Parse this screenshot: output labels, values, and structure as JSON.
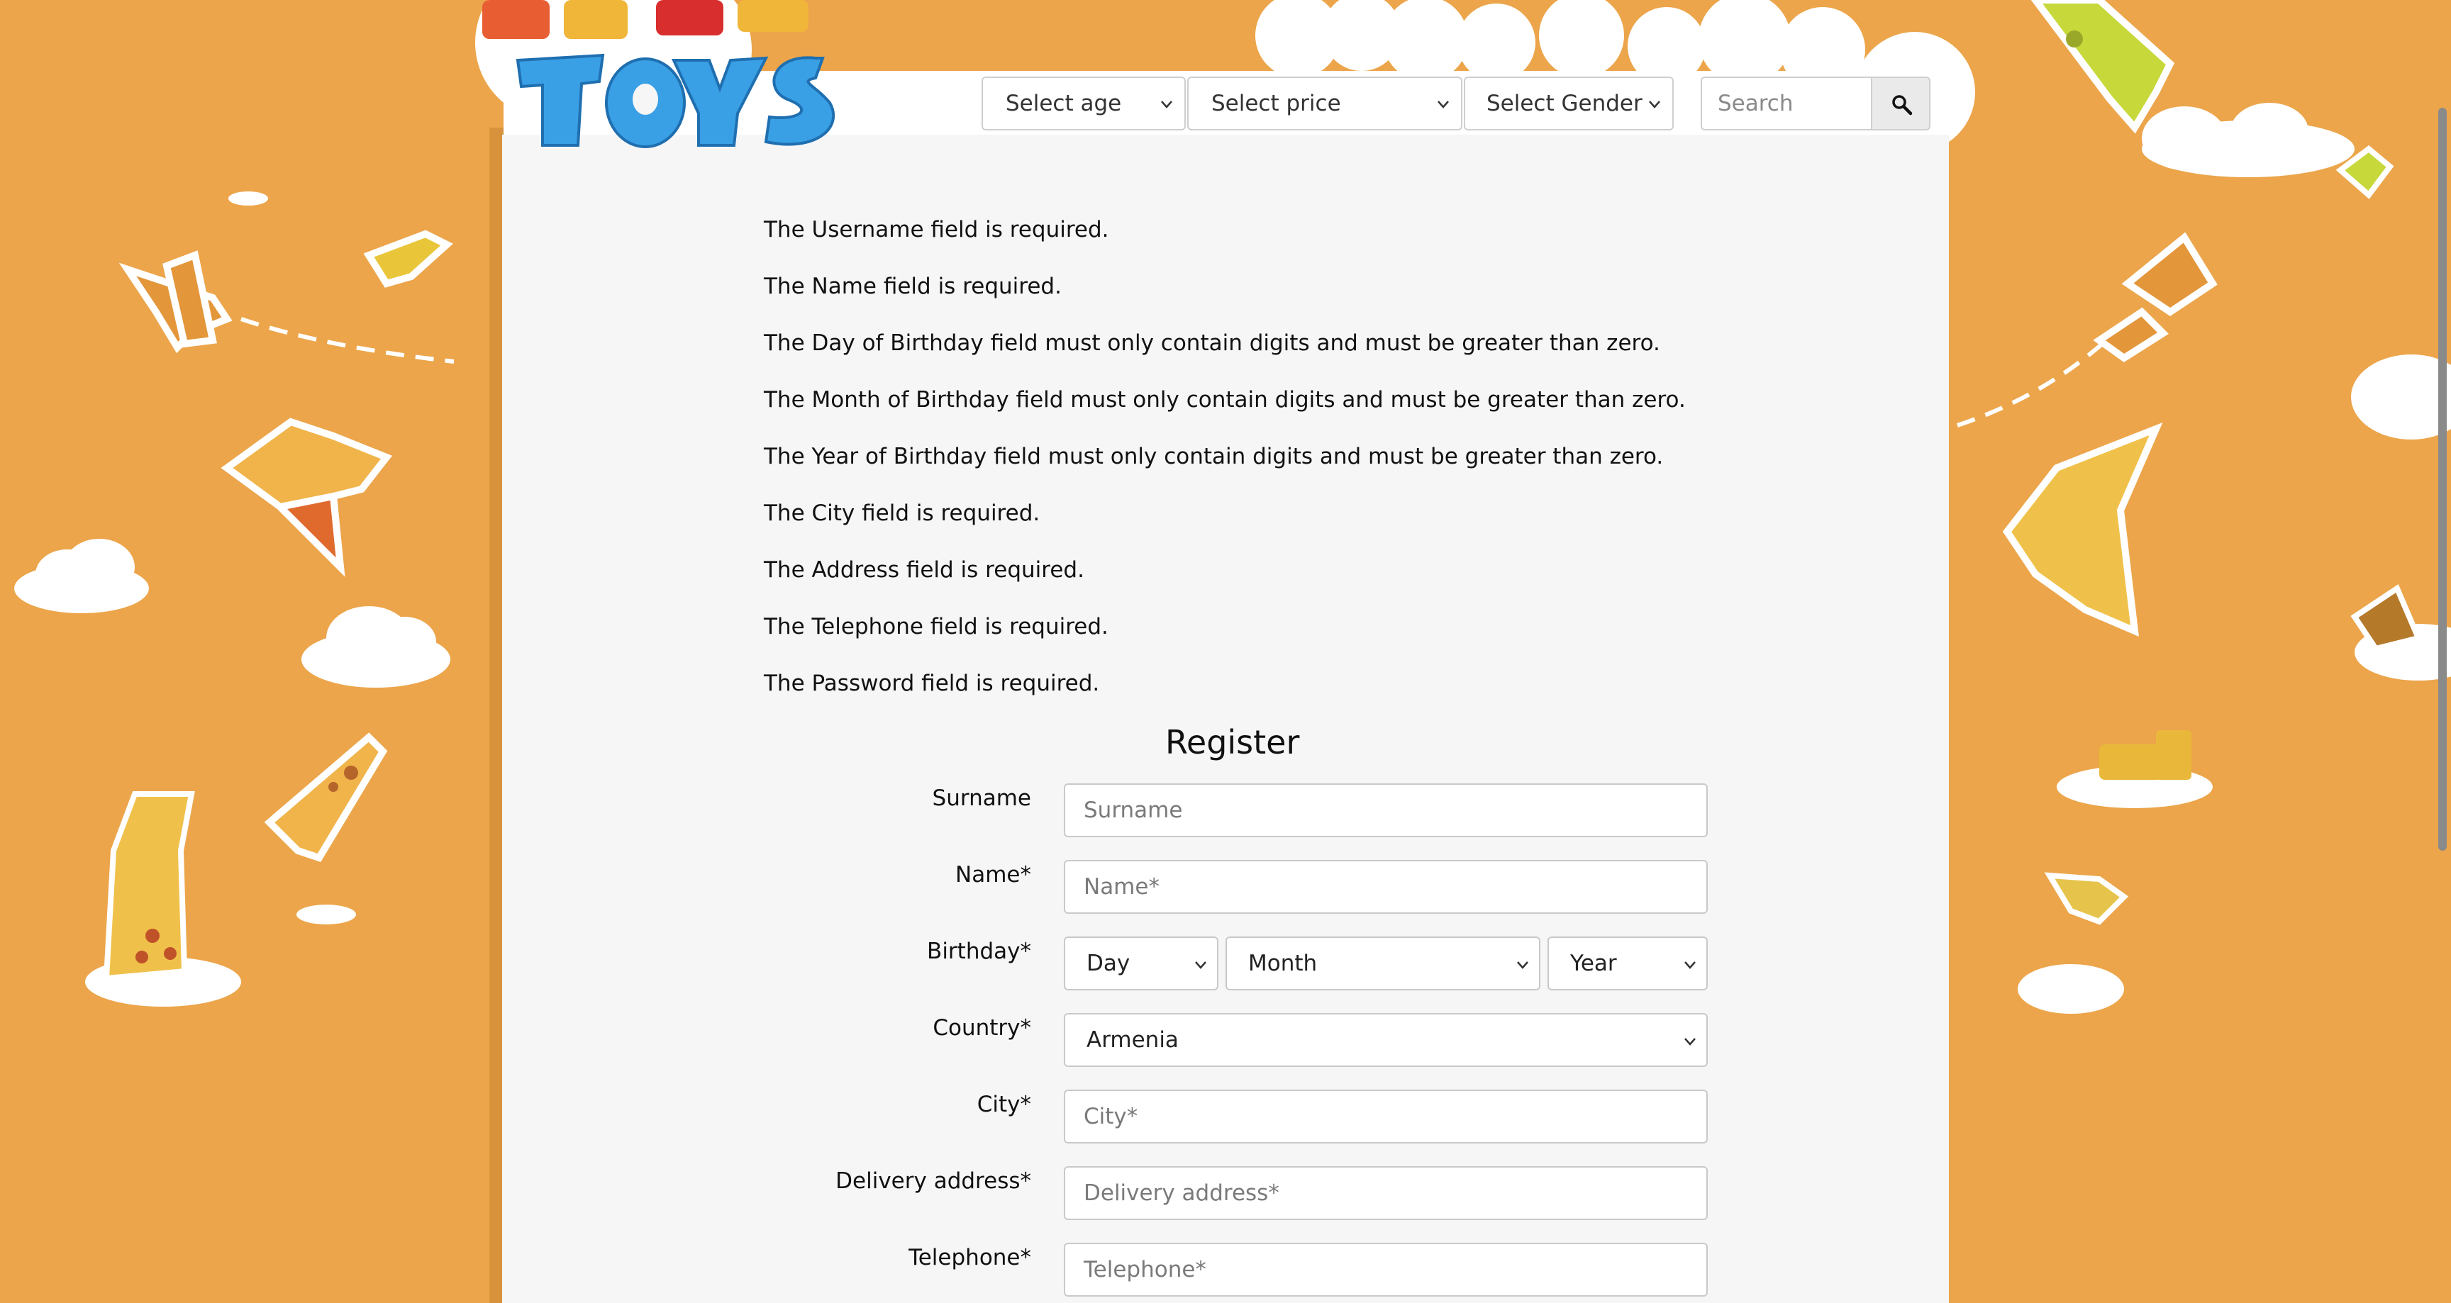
{
  "header": {
    "logo_alt": "MEGA TOYS",
    "filters": {
      "age": "Select age",
      "price": "Select price",
      "gender": "Select Gender"
    },
    "search": {
      "placeholder": "Search"
    }
  },
  "errors": [
    "The Username field is required.",
    "The Name field is required.",
    "The Day of Birthday field must only contain digits and must be greater than zero.",
    "The Month of Birthday field must only contain digits and must be greater than zero.",
    "The Year of Birthday field must only contain digits and must be greater than zero.",
    "The City field is required.",
    "The Address field is required.",
    "The Telephone field is required.",
    "The Password field is required."
  ],
  "form": {
    "title": "Register",
    "surname": {
      "label": "Surname",
      "placeholder": "Surname"
    },
    "name": {
      "label": "Name*",
      "placeholder": "Name*"
    },
    "birthday": {
      "label": "Birthday*",
      "day": "Day",
      "month": "Month",
      "year": "Year"
    },
    "country": {
      "label": "Country*",
      "value": "Armenia"
    },
    "city": {
      "label": "City*",
      "placeholder": "City*"
    },
    "delivery": {
      "label": "Delivery address*",
      "placeholder": "Delivery address*"
    },
    "telephone": {
      "label": "Telephone*",
      "placeholder": "Telephone*"
    }
  },
  "colors": {
    "background": "#eca54a",
    "panel": "#f6f6f6",
    "logo_blue": "#3aa0e6"
  }
}
